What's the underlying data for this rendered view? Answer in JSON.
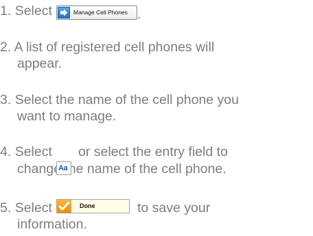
{
  "steps": [
    {
      "number": "1.",
      "lines": [
        "Select"
      ],
      "button": {
        "label": "Manage Cell Phones",
        "icon": "arrow-right-icon"
      },
      "trailing": "."
    },
    {
      "number": "2.",
      "lines": [
        "A list of registered cell phones will",
        "appear."
      ]
    },
    {
      "number": "3.",
      "lines": [
        "Select the name of the cell phone you",
        "want to manage."
      ]
    },
    {
      "number": "4.",
      "lines": [
        "Select",
        "or select the entry field to",
        "change the name of the cell phone."
      ],
      "button": {
        "label": "Aa",
        "icon": "text-edit-icon"
      }
    },
    {
      "number": "5.",
      "lines": [
        "Select",
        "to save your",
        "information."
      ],
      "button": {
        "label": "Done",
        "icon": "check-icon"
      }
    }
  ],
  "colors": {
    "text": "#7d7d7d",
    "manage_icon_blue": "#1f73c7",
    "aa_blue": "#1455b8",
    "done_orange": "#f08a00",
    "done_background": "#fffde7"
  }
}
